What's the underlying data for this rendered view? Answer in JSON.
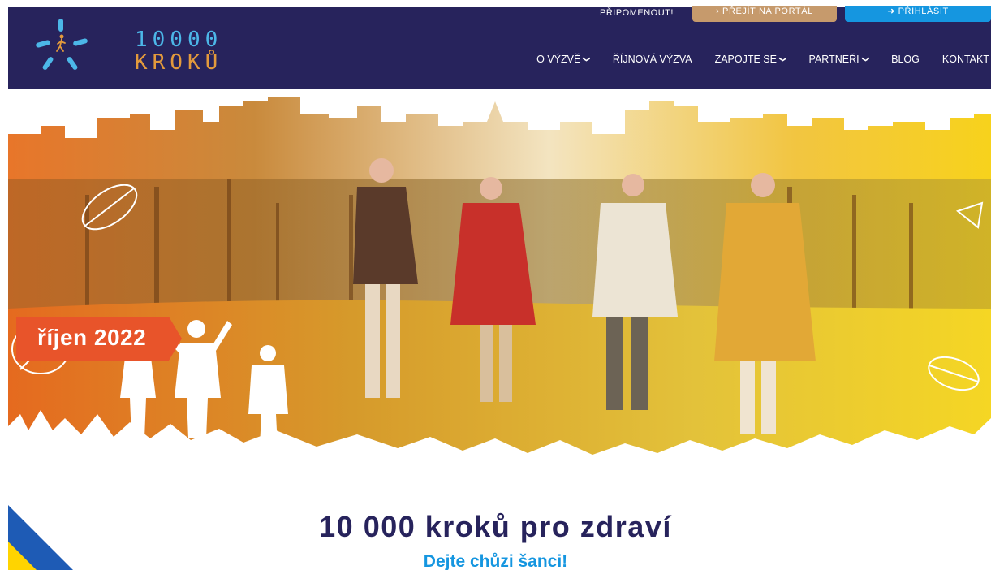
{
  "header": {
    "logo_line1": "10000",
    "logo_line2": "KROKŮ",
    "remind_label": "PŘIPOMENOUT!",
    "portal_button": "› PŘEJÍT NA PORTÁL",
    "login_button": "➜ PŘIHLÁSIT",
    "nav": [
      {
        "label": "O VÝZVĚ",
        "has_dropdown": true
      },
      {
        "label": "ŘÍJNOVÁ VÝZVA",
        "has_dropdown": false
      },
      {
        "label": "ZAPOJTE SE",
        "has_dropdown": true
      },
      {
        "label": "PARTNEŘI",
        "has_dropdown": true
      },
      {
        "label": "BLOG",
        "has_dropdown": false
      },
      {
        "label": "KONTAKT",
        "has_dropdown": false
      }
    ]
  },
  "hero": {
    "badge": "říjen 2022"
  },
  "main": {
    "title": "10 000 kroků pro zdraví",
    "subtitle": "Dejte chůzi šanci!"
  },
  "colors": {
    "header_bg": "#27235c",
    "portal_btn": "#c69a6c",
    "login_btn": "#1596e0",
    "badge": "#e8542a",
    "title": "#27235c",
    "subtitle": "#1596e0",
    "flag_blue": "#1e5bb5",
    "flag_yellow": "#ffd400"
  },
  "icons": {
    "logo": "walking-person-logo-icon",
    "dropdown": "chevron-down-icon",
    "login": "sign-in-icon"
  }
}
